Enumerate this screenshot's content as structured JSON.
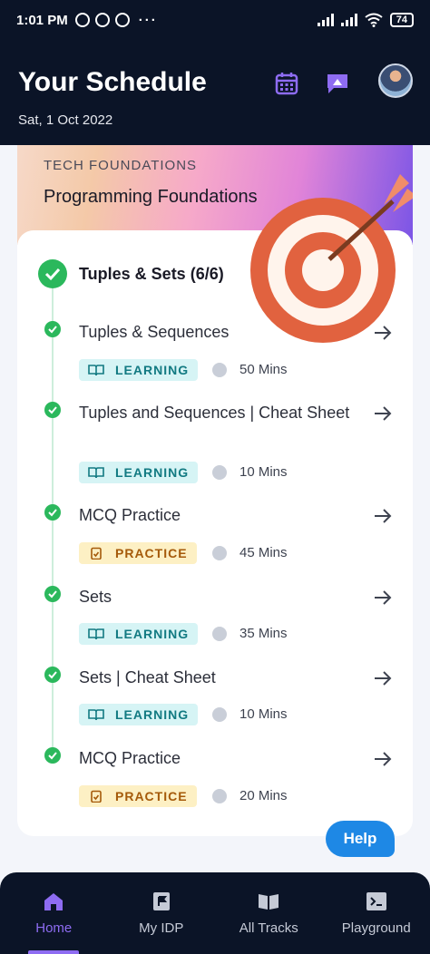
{
  "status": {
    "time": "1:01 PM",
    "battery": "74"
  },
  "header": {
    "title": "Your Schedule",
    "date": "Sat, 1 Oct 2022"
  },
  "card": {
    "category": "TECH FOUNDATIONS",
    "course": "Programming Foundations",
    "section_title": "Tuples & Sets (6/6)",
    "items": [
      {
        "name": "Tuples & Sequences",
        "type": "LEARNING",
        "duration": "50 Mins"
      },
      {
        "name": "Tuples and Sequences | Cheat Sheet",
        "type": "LEARNING",
        "duration": "10 Mins"
      },
      {
        "name": "MCQ Practice",
        "type": "PRACTICE",
        "duration": "45 Mins"
      },
      {
        "name": "Sets",
        "type": "LEARNING",
        "duration": "35 Mins"
      },
      {
        "name": "Sets | Cheat Sheet",
        "type": "LEARNING",
        "duration": "10 Mins"
      },
      {
        "name": "MCQ Practice",
        "type": "PRACTICE",
        "duration": "20 Mins"
      }
    ]
  },
  "help_label": "Help",
  "nav": [
    {
      "label": "Home",
      "icon": "home-icon",
      "active": true
    },
    {
      "label": "My IDP",
      "icon": "flag-doc-icon",
      "active": false
    },
    {
      "label": "All Tracks",
      "icon": "book-open-icon",
      "active": false
    },
    {
      "label": "Playground",
      "icon": "terminal-icon",
      "active": false
    }
  ],
  "colors": {
    "header_bg": "#0b1427",
    "accent": "#8e6cf2",
    "complete_green": "#2bb85c",
    "learning_badge": "#d6f4f5",
    "practice_badge": "#fdf0c4",
    "help_blue": "#1e88e5"
  }
}
